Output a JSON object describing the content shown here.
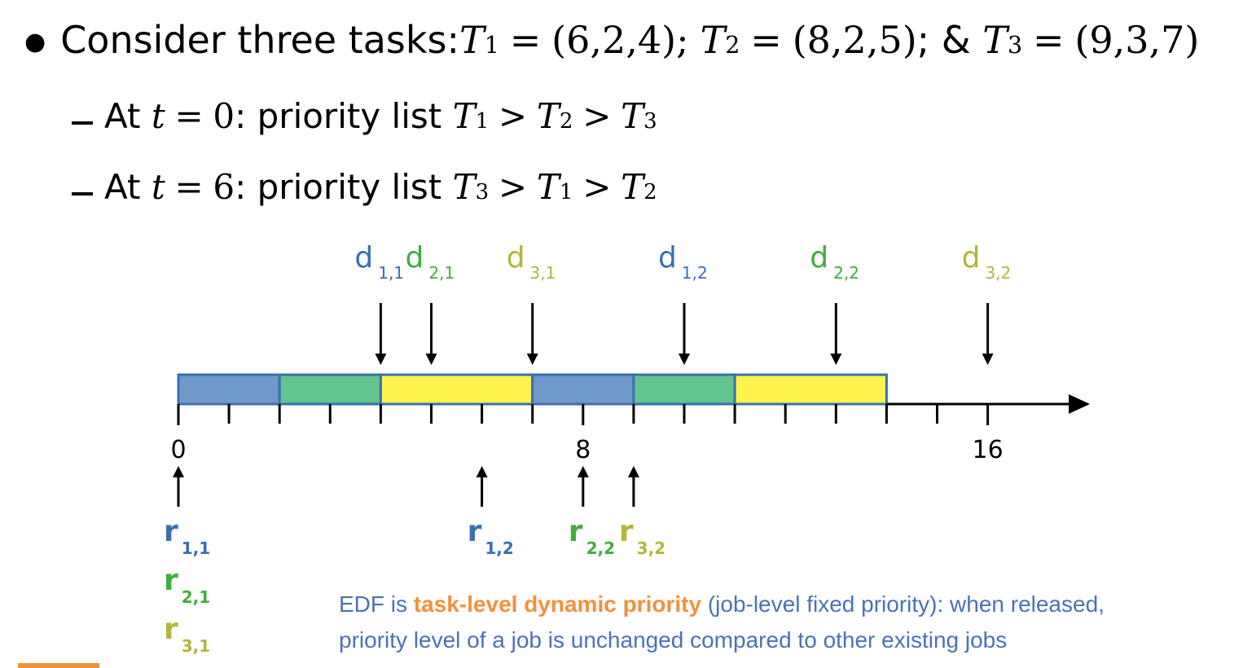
{
  "header": {
    "intro": "Consider three tasks: ",
    "tasks": [
      {
        "name": "T",
        "sub": "1",
        "tuple": "(6,2,4)",
        "after": ";"
      },
      {
        "name": "T",
        "sub": "2",
        "tuple": "(8,2,5)",
        "after": "; & "
      },
      {
        "name": "T",
        "sub": "3",
        "tuple": "(9,3,7)",
        "after": ""
      }
    ]
  },
  "priority_lines": [
    {
      "prefix": "At ",
      "var": "t",
      "value": "0",
      "suffix": ": priority list ",
      "order": [
        "1",
        "2",
        "3"
      ]
    },
    {
      "prefix": "At ",
      "var": "t",
      "value": "6",
      "suffix": ": priority list ",
      "order": [
        "3",
        "1",
        "2"
      ]
    }
  ],
  "colors": {
    "task1": "#3a6fb0",
    "task2": "#3fae3c",
    "task3": "#b2b63a",
    "fill1": "#7099cc",
    "fill2": "#62c48e",
    "fill3": "#fff24c",
    "note_blue": "#4a72b8",
    "note_orange": "#f0923b"
  },
  "chart_data": {
    "type": "timeline",
    "x_ticks": [
      0,
      8,
      16
    ],
    "x_range": [
      0,
      18
    ],
    "schedule": [
      {
        "task": 1,
        "start": 0,
        "end": 2
      },
      {
        "task": 2,
        "start": 2,
        "end": 4
      },
      {
        "task": 3,
        "start": 4,
        "end": 7
      },
      {
        "task": 1,
        "start": 7,
        "end": 9
      },
      {
        "task": 2,
        "start": 9,
        "end": 11
      },
      {
        "task": 3,
        "start": 11,
        "end": 14
      }
    ],
    "deadlines": [
      {
        "task": 1,
        "job": "1,1",
        "t": 4
      },
      {
        "task": 2,
        "job": "2,1",
        "t": 5
      },
      {
        "task": 3,
        "job": "3,1",
        "t": 7
      },
      {
        "task": 1,
        "job": "1,2",
        "t": 10
      },
      {
        "task": 2,
        "job": "2,2",
        "t": 13
      },
      {
        "task": 3,
        "job": "3,2",
        "t": 16
      }
    ],
    "releases": [
      {
        "labels": [
          {
            "task": 1,
            "job": "1,1"
          },
          {
            "task": 2,
            "job": "2,1"
          },
          {
            "task": 3,
            "job": "3,1"
          }
        ],
        "t": 0
      },
      {
        "labels": [
          {
            "task": 1,
            "job": "1,2"
          }
        ],
        "t": 6
      },
      {
        "labels": [
          {
            "task": 2,
            "job": "2,2"
          }
        ],
        "t": 8
      },
      {
        "labels": [
          {
            "task": 3,
            "job": "3,2"
          }
        ],
        "t": 9
      }
    ],
    "deadline_letter": "d",
    "release_letter": "r"
  },
  "note": {
    "part1": "EDF is ",
    "highlight": "task-level dynamic priority",
    "part2": " (job-level fixed priority): when released,",
    "line2": "priority level of a job is unchanged compared to other existing jobs"
  }
}
